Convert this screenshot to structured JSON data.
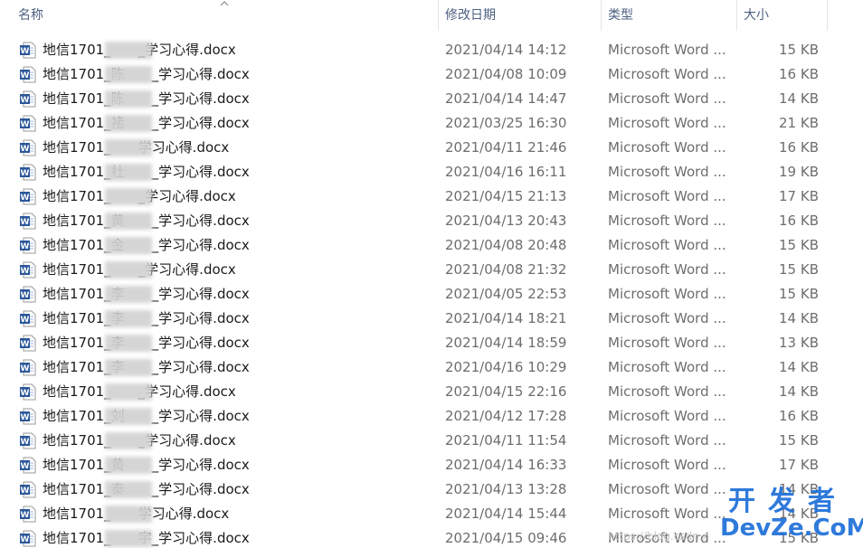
{
  "columns": {
    "name": "名称",
    "date": "修改日期",
    "type": "类型",
    "size": "大小"
  },
  "sort_indicator": "ascending-icon",
  "files": [
    {
      "name": "地信1701_　　_学习心得.docx",
      "date": "2021/04/14 14:12",
      "type": "Microsoft Word ...",
      "size": "15 KB"
    },
    {
      "name": "地信1701_陈　　_学习心得.docx",
      "date": "2021/04/08 10:09",
      "type": "Microsoft Word ...",
      "size": "16 KB"
    },
    {
      "name": "地信1701_陈　　_学习心得.docx",
      "date": "2021/04/14 14:47",
      "type": "Microsoft Word ...",
      "size": "14 KB"
    },
    {
      "name": "地信1701_褚　　_学习心得.docx",
      "date": "2021/03/25 16:30",
      "type": "Microsoft Word ...",
      "size": "21 KB"
    },
    {
      "name": "地信1701_　　学习心得.docx",
      "date": "2021/04/11 21:46",
      "type": "Microsoft Word ...",
      "size": "16 KB"
    },
    {
      "name": "地信1701_杜　　_学习心得.docx",
      "date": "2021/04/16 16:11",
      "type": "Microsoft Word ...",
      "size": "19 KB"
    },
    {
      "name": "地信1701_　　_学习心得.docx",
      "date": "2021/04/15 21:13",
      "type": "Microsoft Word ...",
      "size": "17 KB"
    },
    {
      "name": "地信1701_黄　　_学习心得.docx",
      "date": "2021/04/13 20:43",
      "type": "Microsoft Word ...",
      "size": "16 KB"
    },
    {
      "name": "地信1701_金　　_学习心得.docx",
      "date": "2021/04/08 20:48",
      "type": "Microsoft Word ...",
      "size": "15 KB"
    },
    {
      "name": "地信1701_　　_学习心得.docx",
      "date": "2021/04/08 21:32",
      "type": "Microsoft Word ...",
      "size": "15 KB"
    },
    {
      "name": "地信1701_李　　_学习心得.docx",
      "date": "2021/04/05 22:53",
      "type": "Microsoft Word ...",
      "size": "15 KB"
    },
    {
      "name": "地信1701_李　　_学习心得.docx",
      "date": "2021/04/14 18:21",
      "type": "Microsoft Word ...",
      "size": "14 KB"
    },
    {
      "name": "地信1701_李　　_学习心得.docx",
      "date": "2021/04/14 18:59",
      "type": "Microsoft Word ...",
      "size": "13 KB"
    },
    {
      "name": "地信1701_李　　_学习心得.docx",
      "date": "2021/04/16 10:29",
      "type": "Microsoft Word ...",
      "size": "14 KB"
    },
    {
      "name": "地信1701_　　_学习心得.docx",
      "date": "2021/04/15 22:16",
      "type": "Microsoft Word ...",
      "size": "14 KB"
    },
    {
      "name": "地信1701_刘　　_学习心得.docx",
      "date": "2021/04/12 17:28",
      "type": "Microsoft Word ...",
      "size": "16 KB"
    },
    {
      "name": "地信1701_　　_学习心得.docx",
      "date": "2021/04/11 11:54",
      "type": "Microsoft Word ...",
      "size": "15 KB"
    },
    {
      "name": "地信1701_黄　　_学习心得.docx",
      "date": "2021/04/14 16:33",
      "type": "Microsoft Word ...",
      "size": "17 KB"
    },
    {
      "name": "地信1701_秦　　_学习心得.docx",
      "date": "2021/04/13 13:28",
      "type": "Microsoft Word ...",
      "size": "14 KB"
    },
    {
      "name": "地信1701_　　学习心得.docx",
      "date": "2021/04/14 15:44",
      "type": "Microsoft Word ...",
      "size": "14 KB"
    },
    {
      "name": "地信1701_　　宇_学习心得.docx",
      "date": "2021/04/15 09:46",
      "type": "Microsoft Word ...",
      "size": "15 KB"
    }
  ],
  "file_icon": "word-document-icon",
  "watermark": {
    "top": "开发者",
    "bottom": "DevZe.CoM",
    "url": "https://blog.csdn.n"
  },
  "colors": {
    "header_text": "#4d6082",
    "word_blue": "#2b579a",
    "watermark_blue": "#1e6fd9"
  }
}
